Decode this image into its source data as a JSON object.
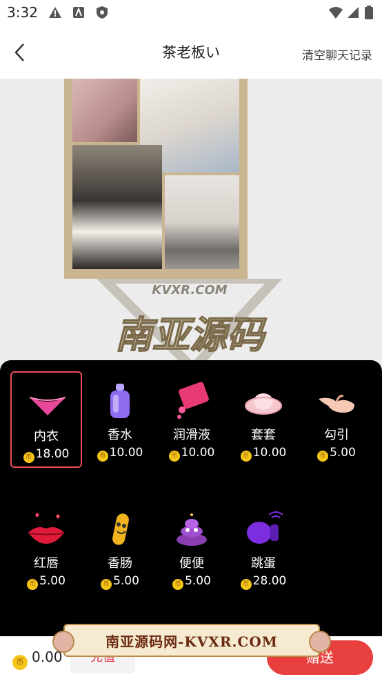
{
  "status_bar": {
    "time": "3:32"
  },
  "header": {
    "title": "茶老板い",
    "clear_label": "清空聊天记录"
  },
  "watermark": {
    "top_text": "KVXR.COM",
    "main_text": "南亚源码",
    "banner_text": "南亚源码网-KVXR.COM"
  },
  "gifts": [
    {
      "name": "内衣",
      "price": "18.00",
      "icon": "thong-icon",
      "selected": true
    },
    {
      "name": "香水",
      "price": "10.00",
      "icon": "perfume-icon"
    },
    {
      "name": "润滑液",
      "price": "10.00",
      "icon": "lubricant-icon"
    },
    {
      "name": "套套",
      "price": "10.00",
      "icon": "condom-icon"
    },
    {
      "name": "勾引",
      "price": "5.00",
      "icon": "beckon-hand-icon"
    },
    {
      "name": "红唇",
      "price": "5.00",
      "icon": "red-lips-icon"
    },
    {
      "name": "香肠",
      "price": "5.00",
      "icon": "sausage-icon"
    },
    {
      "name": "便便",
      "price": "5.00",
      "icon": "poop-icon"
    },
    {
      "name": "跳蛋",
      "price": "28.00",
      "icon": "vibrator-icon"
    }
  ],
  "coin_symbol": "币",
  "footer": {
    "balance": "0.00",
    "recharge_label": "充值",
    "send_label": "赠送"
  },
  "colors": {
    "accent": "#e8403f",
    "selected_border": "#ef4d5e",
    "coin": "#f5c518"
  }
}
